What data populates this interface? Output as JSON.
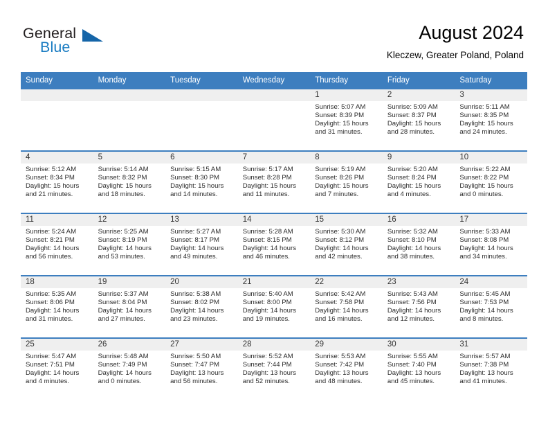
{
  "brand": {
    "name_part1": "General",
    "name_part2": "Blue",
    "logo_icon": "triangle-icon",
    "color_dark": "#231f20",
    "color_blue": "#1a7cc2"
  },
  "header": {
    "title": "August 2024",
    "subtitle": "Kleczew, Greater Poland, Poland",
    "accent_color": "#3d7ebf"
  },
  "weekdays": [
    "Sunday",
    "Monday",
    "Tuesday",
    "Wednesday",
    "Thursday",
    "Friday",
    "Saturday"
  ],
  "labels": {
    "sunrise_prefix": "Sunrise:",
    "sunset_prefix": "Sunset:",
    "daylight_prefix": "Daylight:"
  },
  "weeks": [
    [
      {
        "day": "",
        "empty": true
      },
      {
        "day": "",
        "empty": true
      },
      {
        "day": "",
        "empty": true
      },
      {
        "day": "",
        "empty": true
      },
      {
        "day": "1",
        "sunrise": "Sunrise: 5:07 AM",
        "sunset": "Sunset: 8:39 PM",
        "daylight": "Daylight: 15 hours and 31 minutes."
      },
      {
        "day": "2",
        "sunrise": "Sunrise: 5:09 AM",
        "sunset": "Sunset: 8:37 PM",
        "daylight": "Daylight: 15 hours and 28 minutes."
      },
      {
        "day": "3",
        "sunrise": "Sunrise: 5:11 AM",
        "sunset": "Sunset: 8:35 PM",
        "daylight": "Daylight: 15 hours and 24 minutes."
      }
    ],
    [
      {
        "day": "4",
        "sunrise": "Sunrise: 5:12 AM",
        "sunset": "Sunset: 8:34 PM",
        "daylight": "Daylight: 15 hours and 21 minutes."
      },
      {
        "day": "5",
        "sunrise": "Sunrise: 5:14 AM",
        "sunset": "Sunset: 8:32 PM",
        "daylight": "Daylight: 15 hours and 18 minutes."
      },
      {
        "day": "6",
        "sunrise": "Sunrise: 5:15 AM",
        "sunset": "Sunset: 8:30 PM",
        "daylight": "Daylight: 15 hours and 14 minutes."
      },
      {
        "day": "7",
        "sunrise": "Sunrise: 5:17 AM",
        "sunset": "Sunset: 8:28 PM",
        "daylight": "Daylight: 15 hours and 11 minutes."
      },
      {
        "day": "8",
        "sunrise": "Sunrise: 5:19 AM",
        "sunset": "Sunset: 8:26 PM",
        "daylight": "Daylight: 15 hours and 7 minutes."
      },
      {
        "day": "9",
        "sunrise": "Sunrise: 5:20 AM",
        "sunset": "Sunset: 8:24 PM",
        "daylight": "Daylight: 15 hours and 4 minutes."
      },
      {
        "day": "10",
        "sunrise": "Sunrise: 5:22 AM",
        "sunset": "Sunset: 8:22 PM",
        "daylight": "Daylight: 15 hours and 0 minutes."
      }
    ],
    [
      {
        "day": "11",
        "sunrise": "Sunrise: 5:24 AM",
        "sunset": "Sunset: 8:21 PM",
        "daylight": "Daylight: 14 hours and 56 minutes."
      },
      {
        "day": "12",
        "sunrise": "Sunrise: 5:25 AM",
        "sunset": "Sunset: 8:19 PM",
        "daylight": "Daylight: 14 hours and 53 minutes."
      },
      {
        "day": "13",
        "sunrise": "Sunrise: 5:27 AM",
        "sunset": "Sunset: 8:17 PM",
        "daylight": "Daylight: 14 hours and 49 minutes."
      },
      {
        "day": "14",
        "sunrise": "Sunrise: 5:28 AM",
        "sunset": "Sunset: 8:15 PM",
        "daylight": "Daylight: 14 hours and 46 minutes."
      },
      {
        "day": "15",
        "sunrise": "Sunrise: 5:30 AM",
        "sunset": "Sunset: 8:12 PM",
        "daylight": "Daylight: 14 hours and 42 minutes."
      },
      {
        "day": "16",
        "sunrise": "Sunrise: 5:32 AM",
        "sunset": "Sunset: 8:10 PM",
        "daylight": "Daylight: 14 hours and 38 minutes."
      },
      {
        "day": "17",
        "sunrise": "Sunrise: 5:33 AM",
        "sunset": "Sunset: 8:08 PM",
        "daylight": "Daylight: 14 hours and 34 minutes."
      }
    ],
    [
      {
        "day": "18",
        "sunrise": "Sunrise: 5:35 AM",
        "sunset": "Sunset: 8:06 PM",
        "daylight": "Daylight: 14 hours and 31 minutes."
      },
      {
        "day": "19",
        "sunrise": "Sunrise: 5:37 AM",
        "sunset": "Sunset: 8:04 PM",
        "daylight": "Daylight: 14 hours and 27 minutes."
      },
      {
        "day": "20",
        "sunrise": "Sunrise: 5:38 AM",
        "sunset": "Sunset: 8:02 PM",
        "daylight": "Daylight: 14 hours and 23 minutes."
      },
      {
        "day": "21",
        "sunrise": "Sunrise: 5:40 AM",
        "sunset": "Sunset: 8:00 PM",
        "daylight": "Daylight: 14 hours and 19 minutes."
      },
      {
        "day": "22",
        "sunrise": "Sunrise: 5:42 AM",
        "sunset": "Sunset: 7:58 PM",
        "daylight": "Daylight: 14 hours and 16 minutes."
      },
      {
        "day": "23",
        "sunrise": "Sunrise: 5:43 AM",
        "sunset": "Sunset: 7:56 PM",
        "daylight": "Daylight: 14 hours and 12 minutes."
      },
      {
        "day": "24",
        "sunrise": "Sunrise: 5:45 AM",
        "sunset": "Sunset: 7:53 PM",
        "daylight": "Daylight: 14 hours and 8 minutes."
      }
    ],
    [
      {
        "day": "25",
        "sunrise": "Sunrise: 5:47 AM",
        "sunset": "Sunset: 7:51 PM",
        "daylight": "Daylight: 14 hours and 4 minutes."
      },
      {
        "day": "26",
        "sunrise": "Sunrise: 5:48 AM",
        "sunset": "Sunset: 7:49 PM",
        "daylight": "Daylight: 14 hours and 0 minutes."
      },
      {
        "day": "27",
        "sunrise": "Sunrise: 5:50 AM",
        "sunset": "Sunset: 7:47 PM",
        "daylight": "Daylight: 13 hours and 56 minutes."
      },
      {
        "day": "28",
        "sunrise": "Sunrise: 5:52 AM",
        "sunset": "Sunset: 7:44 PM",
        "daylight": "Daylight: 13 hours and 52 minutes."
      },
      {
        "day": "29",
        "sunrise": "Sunrise: 5:53 AM",
        "sunset": "Sunset: 7:42 PM",
        "daylight": "Daylight: 13 hours and 48 minutes."
      },
      {
        "day": "30",
        "sunrise": "Sunrise: 5:55 AM",
        "sunset": "Sunset: 7:40 PM",
        "daylight": "Daylight: 13 hours and 45 minutes."
      },
      {
        "day": "31",
        "sunrise": "Sunrise: 5:57 AM",
        "sunset": "Sunset: 7:38 PM",
        "daylight": "Daylight: 13 hours and 41 minutes."
      }
    ]
  ]
}
